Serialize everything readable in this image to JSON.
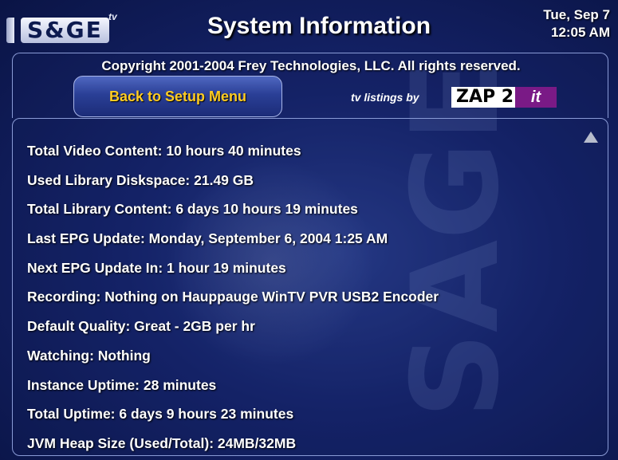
{
  "header": {
    "logo_text": "S&GE",
    "logo_tv": "tv",
    "title": "System Information",
    "date": "Tue, Sep 7",
    "time": "12:05 AM"
  },
  "top_panel": {
    "copyright": "Copyright 2001-2004 Frey Technologies, LLC. All rights reserved.",
    "back_button_label": "Back to Setup Menu",
    "listings_label": "tv listings by",
    "listings_brand": "ZAP 2",
    "listings_brand_suffix": "it"
  },
  "info": {
    "items": [
      "Total Video Content: 10 hours 40 minutes",
      "Used Library Diskspace: 21.49 GB",
      "Total Library Content: 6 days 10 hours 19 minutes",
      "Last EPG Update: Monday, September 6, 2004 1:25 AM",
      "Next EPG Update In: 1 hour 19 minutes",
      "Recording: Nothing on Hauppauge WinTV PVR USB2 Encoder",
      "Default Quality: Great - 2GB per hr",
      "Watching: Nothing",
      "Instance Uptime: 28 minutes",
      "Total Uptime: 6 days 9 hours 23 minutes",
      "JVM Heap Size (Used/Total): 24MB/32MB"
    ]
  },
  "colors": {
    "background": "#15236a",
    "button_text": "#ffcc22",
    "panel_border": "#8a9bd6",
    "zap_it": "#7a1a86"
  }
}
